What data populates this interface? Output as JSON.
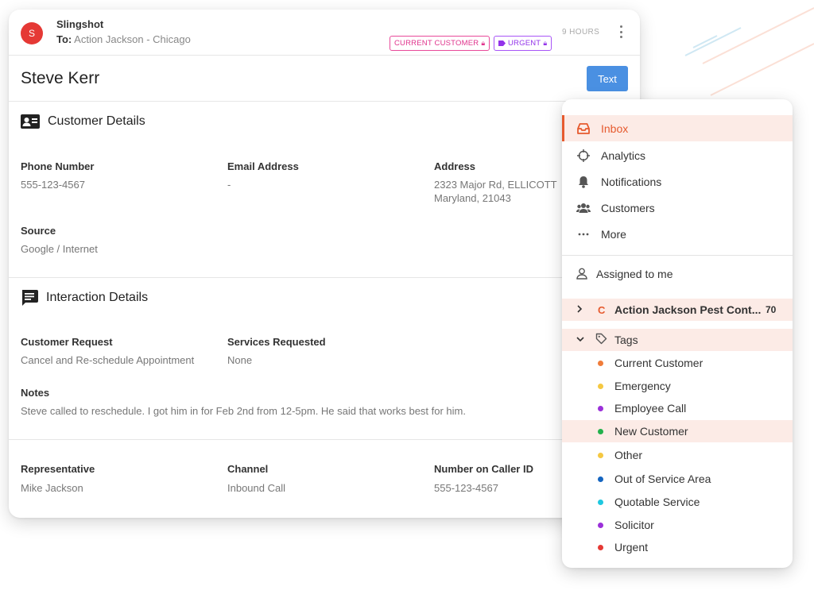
{
  "message": {
    "avatar_letter": "S",
    "sender": "Slingshot",
    "to_prefix": "To:",
    "to_value": "Action Jackson - Chicago",
    "chips": [
      {
        "label": "CURRENT CUSTOMER",
        "color": "#e0338c"
      },
      {
        "label": "URGENT",
        "color": "#9333ea"
      }
    ],
    "time": "9 HOURS"
  },
  "customer": {
    "name": "Steve Kerr",
    "text_button": "Text"
  },
  "customer_details": {
    "title": "Customer Details",
    "phone_label": "Phone Number",
    "phone_value": "555-123-4567",
    "email_label": "Email Address",
    "email_value": "-",
    "address_label": "Address",
    "address_line1": "2323 Major Rd, ELLICOTT",
    "address_line2": "Maryland, 21043",
    "source_label": "Source",
    "source_value": "Google / Internet"
  },
  "interaction_details": {
    "title": "Interaction Details",
    "request_label": "Customer Request",
    "request_value": "Cancel and Re-schedule Appointment",
    "services_label": "Services Requested",
    "services_value": "None",
    "notes_label": "Notes",
    "notes_value": "Steve called to reschedule. I got him in for Feb 2nd from 12-5pm. He said that works best for him."
  },
  "footer_details": {
    "rep_label": "Representative",
    "rep_value": "Mike Jackson",
    "channel_label": "Channel",
    "channel_value": "Inbound Call",
    "callerid_label": "Number on Caller ID",
    "callerid_value": "555-123-4567"
  },
  "nav": {
    "items": [
      {
        "label": "Inbox",
        "icon": "inbox-icon",
        "active": true
      },
      {
        "label": "Analytics",
        "icon": "crosshair-icon",
        "active": false
      },
      {
        "label": "Notifications",
        "icon": "bell-icon",
        "active": false
      },
      {
        "label": "Customers",
        "icon": "people-icon",
        "active": false
      },
      {
        "label": "More",
        "icon": "more-dots-icon",
        "active": false
      }
    ],
    "assigned": "Assigned to me",
    "account_letter": "C",
    "account_name": "Action Jackson Pest Cont...",
    "account_count": "70",
    "tags_label": "Tags",
    "tags": [
      {
        "label": "Current Customer",
        "color": "#f07c3a"
      },
      {
        "label": "Emergency",
        "color": "#f5c842"
      },
      {
        "label": "Employee Call",
        "color": "#9b30d9"
      },
      {
        "label": "New Customer",
        "color": "#22b14c"
      },
      {
        "label": "Other",
        "color": "#f5c842"
      },
      {
        "label": "Out of Service Area",
        "color": "#1565c0"
      },
      {
        "label": "Quotable Service",
        "color": "#1ec8e0"
      },
      {
        "label": "Solicitor",
        "color": "#9b30d9"
      },
      {
        "label": "Urgent",
        "color": "#e53935"
      }
    ]
  },
  "colors": {
    "accent": "#e65a2e",
    "button_blue": "#4a90e2"
  }
}
